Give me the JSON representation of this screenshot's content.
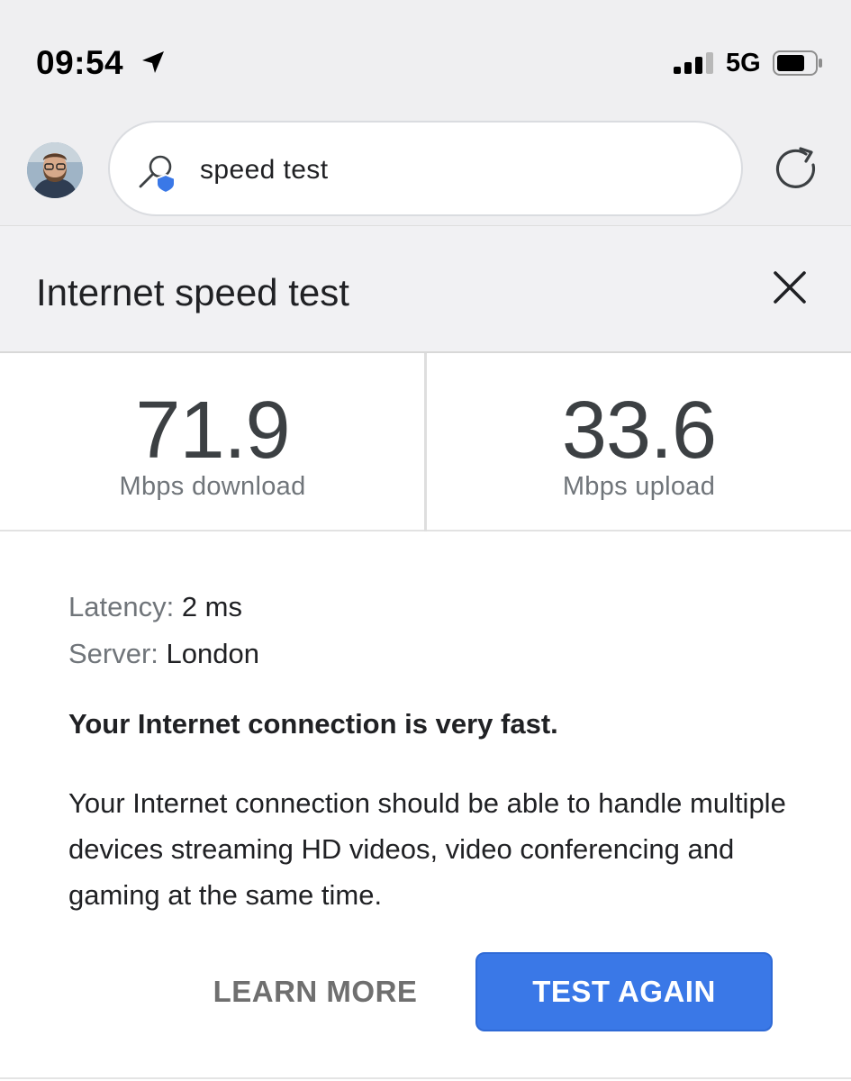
{
  "status_bar": {
    "time": "09:54",
    "network": "5G",
    "icons": [
      "location-arrow-icon",
      "signal-icon",
      "battery-icon"
    ]
  },
  "search": {
    "query": "speed test",
    "icons": [
      "search-icon",
      "refresh-icon"
    ]
  },
  "card": {
    "title": "Internet speed test",
    "download": {
      "value": "71.9",
      "label": "Mbps download"
    },
    "upload": {
      "value": "33.6",
      "label": "Mbps upload"
    },
    "latency": {
      "key": "Latency:",
      "value": "2 ms"
    },
    "server": {
      "key": "Server:",
      "value": "London"
    },
    "headline": "Your Internet connection is very fast.",
    "body": "Your Internet connection should be able to handle multiple devices streaming HD videos, video conferencing and gaming at the same time.",
    "learn_more_label": "LEARN MORE",
    "test_again_label": "TEST AGAIN"
  },
  "colors": {
    "accent": "#3a78e7",
    "header_bg": "#efeff1",
    "muted_text": "#70757a"
  }
}
